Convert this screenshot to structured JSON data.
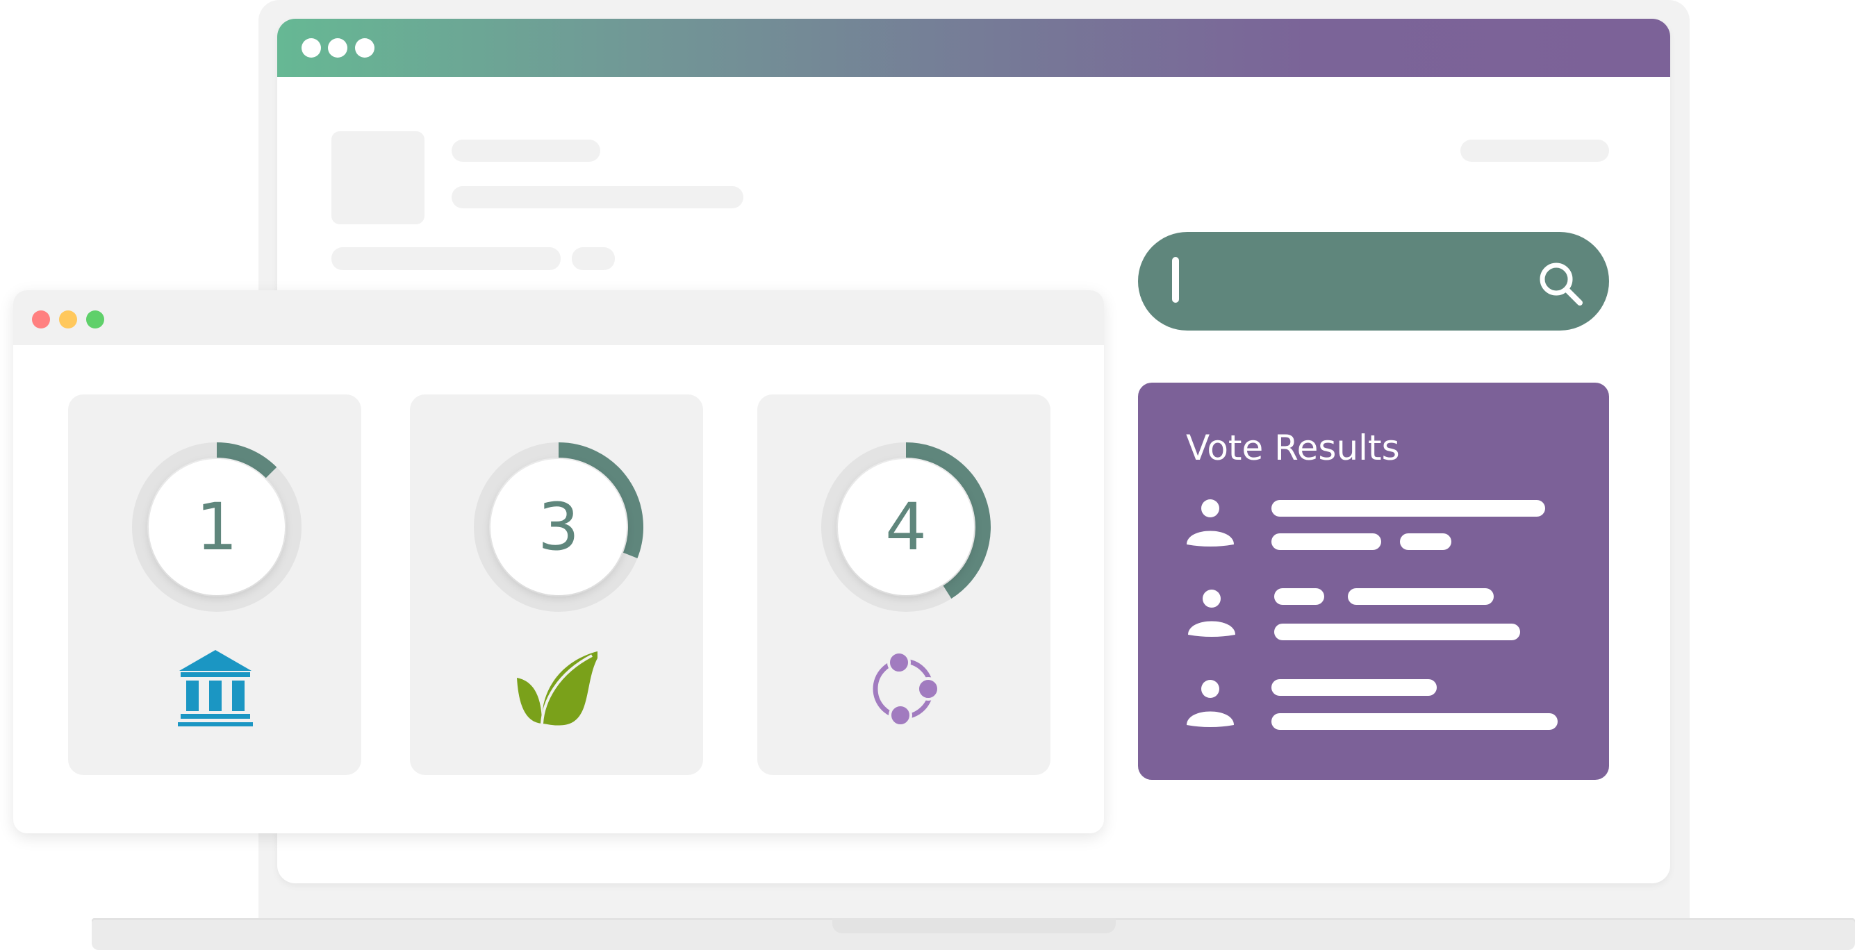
{
  "main_window": {
    "titlebar_gradient": [
      "#66b894",
      "#7c6298"
    ]
  },
  "search": {
    "bar_color": "#5f867c",
    "icon": "search-icon"
  },
  "vote_results": {
    "title": "Vote Results",
    "panel_color": "#7c6198",
    "entries": 3
  },
  "scores": [
    {
      "value": "1",
      "progress": 0.125,
      "icon": "government-building-icon",
      "icon_color": "#1b96c3"
    },
    {
      "value": "3",
      "progress": 0.31,
      "icon": "leaf-sprout-icon",
      "icon_color": "#7aa11a"
    },
    {
      "value": "4",
      "progress": 0.41,
      "icon": "network-cycle-icon",
      "icon_color": "#a17bbf"
    }
  ],
  "colors": {
    "accent_green": "#5f867c",
    "traffic_red": "#ff8080",
    "traffic_yellow": "#ffc85c",
    "traffic_green": "#5fd06a"
  }
}
